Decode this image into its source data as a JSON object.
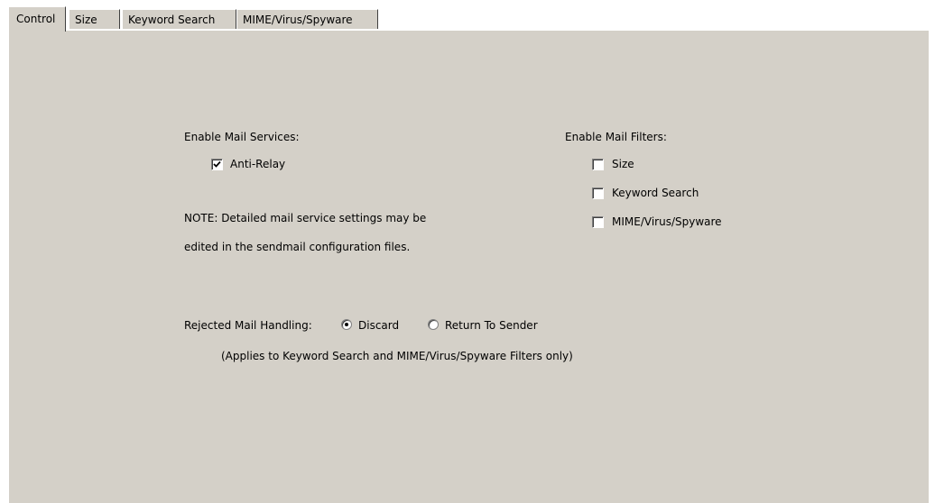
{
  "tabs": [
    {
      "label": "Control",
      "active": true
    },
    {
      "label": "Size",
      "active": false
    },
    {
      "label": "Keyword Search",
      "active": false
    },
    {
      "label": "MIME/Virus/Spyware",
      "active": false
    }
  ],
  "services": {
    "heading": "Enable Mail Services:",
    "anti_relay": {
      "label": "Anti-Relay",
      "checked": true
    }
  },
  "filters": {
    "heading": "Enable Mail Filters:",
    "items": [
      {
        "label": "Size",
        "checked": false
      },
      {
        "label": "Keyword Search",
        "checked": false
      },
      {
        "label": "MIME/Virus/Spyware",
        "checked": false
      }
    ]
  },
  "note": {
    "line1": "NOTE: Detailed mail service settings may be",
    "line2": "edited in the sendmail configuration files."
  },
  "rejected": {
    "label": "Rejected Mail Handling:",
    "options": [
      {
        "label": "Discard",
        "selected": true
      },
      {
        "label": "Return To Sender",
        "selected": false
      }
    ],
    "footnote": "(Applies to Keyword Search and MIME/Virus/Spyware Filters only)"
  }
}
